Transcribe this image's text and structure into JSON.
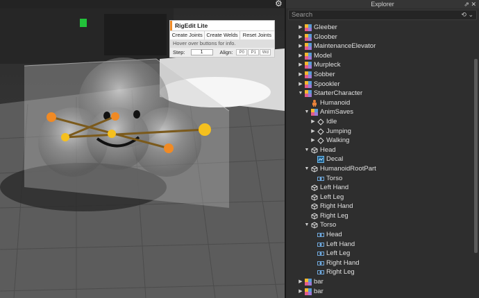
{
  "viewport": {
    "rigedit": {
      "title": "RigEdit Lite",
      "buttons": [
        "Create Joints",
        "Create Welds",
        "Reset Joints"
      ],
      "hint": "Hover over buttons for info.",
      "step_label": "Step:",
      "step_value": "1",
      "align_label": "Align:",
      "align_options": [
        "P0",
        "P1",
        "Wd"
      ]
    }
  },
  "explorer": {
    "title": "Explorer",
    "search_placeholder": "Search",
    "items": [
      {
        "label": "Gleeber",
        "depth": 0,
        "arrow": "collapsed",
        "icon": "model"
      },
      {
        "label": "Gloober",
        "depth": 0,
        "arrow": "collapsed",
        "icon": "model"
      },
      {
        "label": "MaintenanceElevator",
        "depth": 0,
        "arrow": "collapsed",
        "icon": "model"
      },
      {
        "label": "Model",
        "depth": 0,
        "arrow": "collapsed",
        "icon": "model"
      },
      {
        "label": "Murpleck",
        "depth": 0,
        "arrow": "collapsed",
        "icon": "model"
      },
      {
        "label": "Sobber",
        "depth": 0,
        "arrow": "collapsed",
        "icon": "model"
      },
      {
        "label": "Spookler",
        "depth": 0,
        "arrow": "collapsed",
        "icon": "model"
      },
      {
        "label": "StarterCharacter",
        "depth": 0,
        "arrow": "expanded",
        "icon": "model"
      },
      {
        "label": "Humanoid",
        "depth": 1,
        "arrow": "none",
        "icon": "humanoid"
      },
      {
        "label": "AnimSaves",
        "depth": 1,
        "arrow": "expanded",
        "icon": "model"
      },
      {
        "label": "Idle",
        "depth": 2,
        "arrow": "collapsed",
        "icon": "keyframe"
      },
      {
        "label": "Jumping",
        "depth": 2,
        "arrow": "collapsed",
        "icon": "keyframe"
      },
      {
        "label": "Walking",
        "depth": 2,
        "arrow": "collapsed",
        "icon": "keyframe"
      },
      {
        "label": "Head",
        "depth": 1,
        "arrow": "expanded",
        "icon": "part"
      },
      {
        "label": "Decal",
        "depth": 2,
        "arrow": "none",
        "icon": "decal"
      },
      {
        "label": "HumanoidRootPart",
        "depth": 1,
        "arrow": "expanded",
        "icon": "part"
      },
      {
        "label": "Torso",
        "depth": 2,
        "arrow": "none",
        "icon": "motor"
      },
      {
        "label": "Left Hand",
        "depth": 1,
        "arrow": "none",
        "icon": "part"
      },
      {
        "label": "Left Leg",
        "depth": 1,
        "arrow": "none",
        "icon": "part"
      },
      {
        "label": "Right Hand",
        "depth": 1,
        "arrow": "none",
        "icon": "part"
      },
      {
        "label": "Right Leg",
        "depth": 1,
        "arrow": "none",
        "icon": "part"
      },
      {
        "label": "Torso",
        "depth": 1,
        "arrow": "expanded",
        "icon": "part"
      },
      {
        "label": "Head",
        "depth": 2,
        "arrow": "none",
        "icon": "motor"
      },
      {
        "label": "Left Hand",
        "depth": 2,
        "arrow": "none",
        "icon": "motor"
      },
      {
        "label": "Left Leg",
        "depth": 2,
        "arrow": "none",
        "icon": "motor"
      },
      {
        "label": "Right Hand",
        "depth": 2,
        "arrow": "none",
        "icon": "motor"
      },
      {
        "label": "Right Leg",
        "depth": 2,
        "arrow": "none",
        "icon": "motor"
      },
      {
        "label": "bar",
        "depth": 0,
        "arrow": "collapsed",
        "icon": "model"
      },
      {
        "label": "bar",
        "depth": 0,
        "arrow": "collapsed",
        "icon": "model"
      }
    ]
  },
  "colors": {
    "accent": "#f08a24",
    "joint_orange": "#f08a24",
    "joint_yellow": "#f5c01e",
    "motor_blue": "#6fa8dc"
  }
}
